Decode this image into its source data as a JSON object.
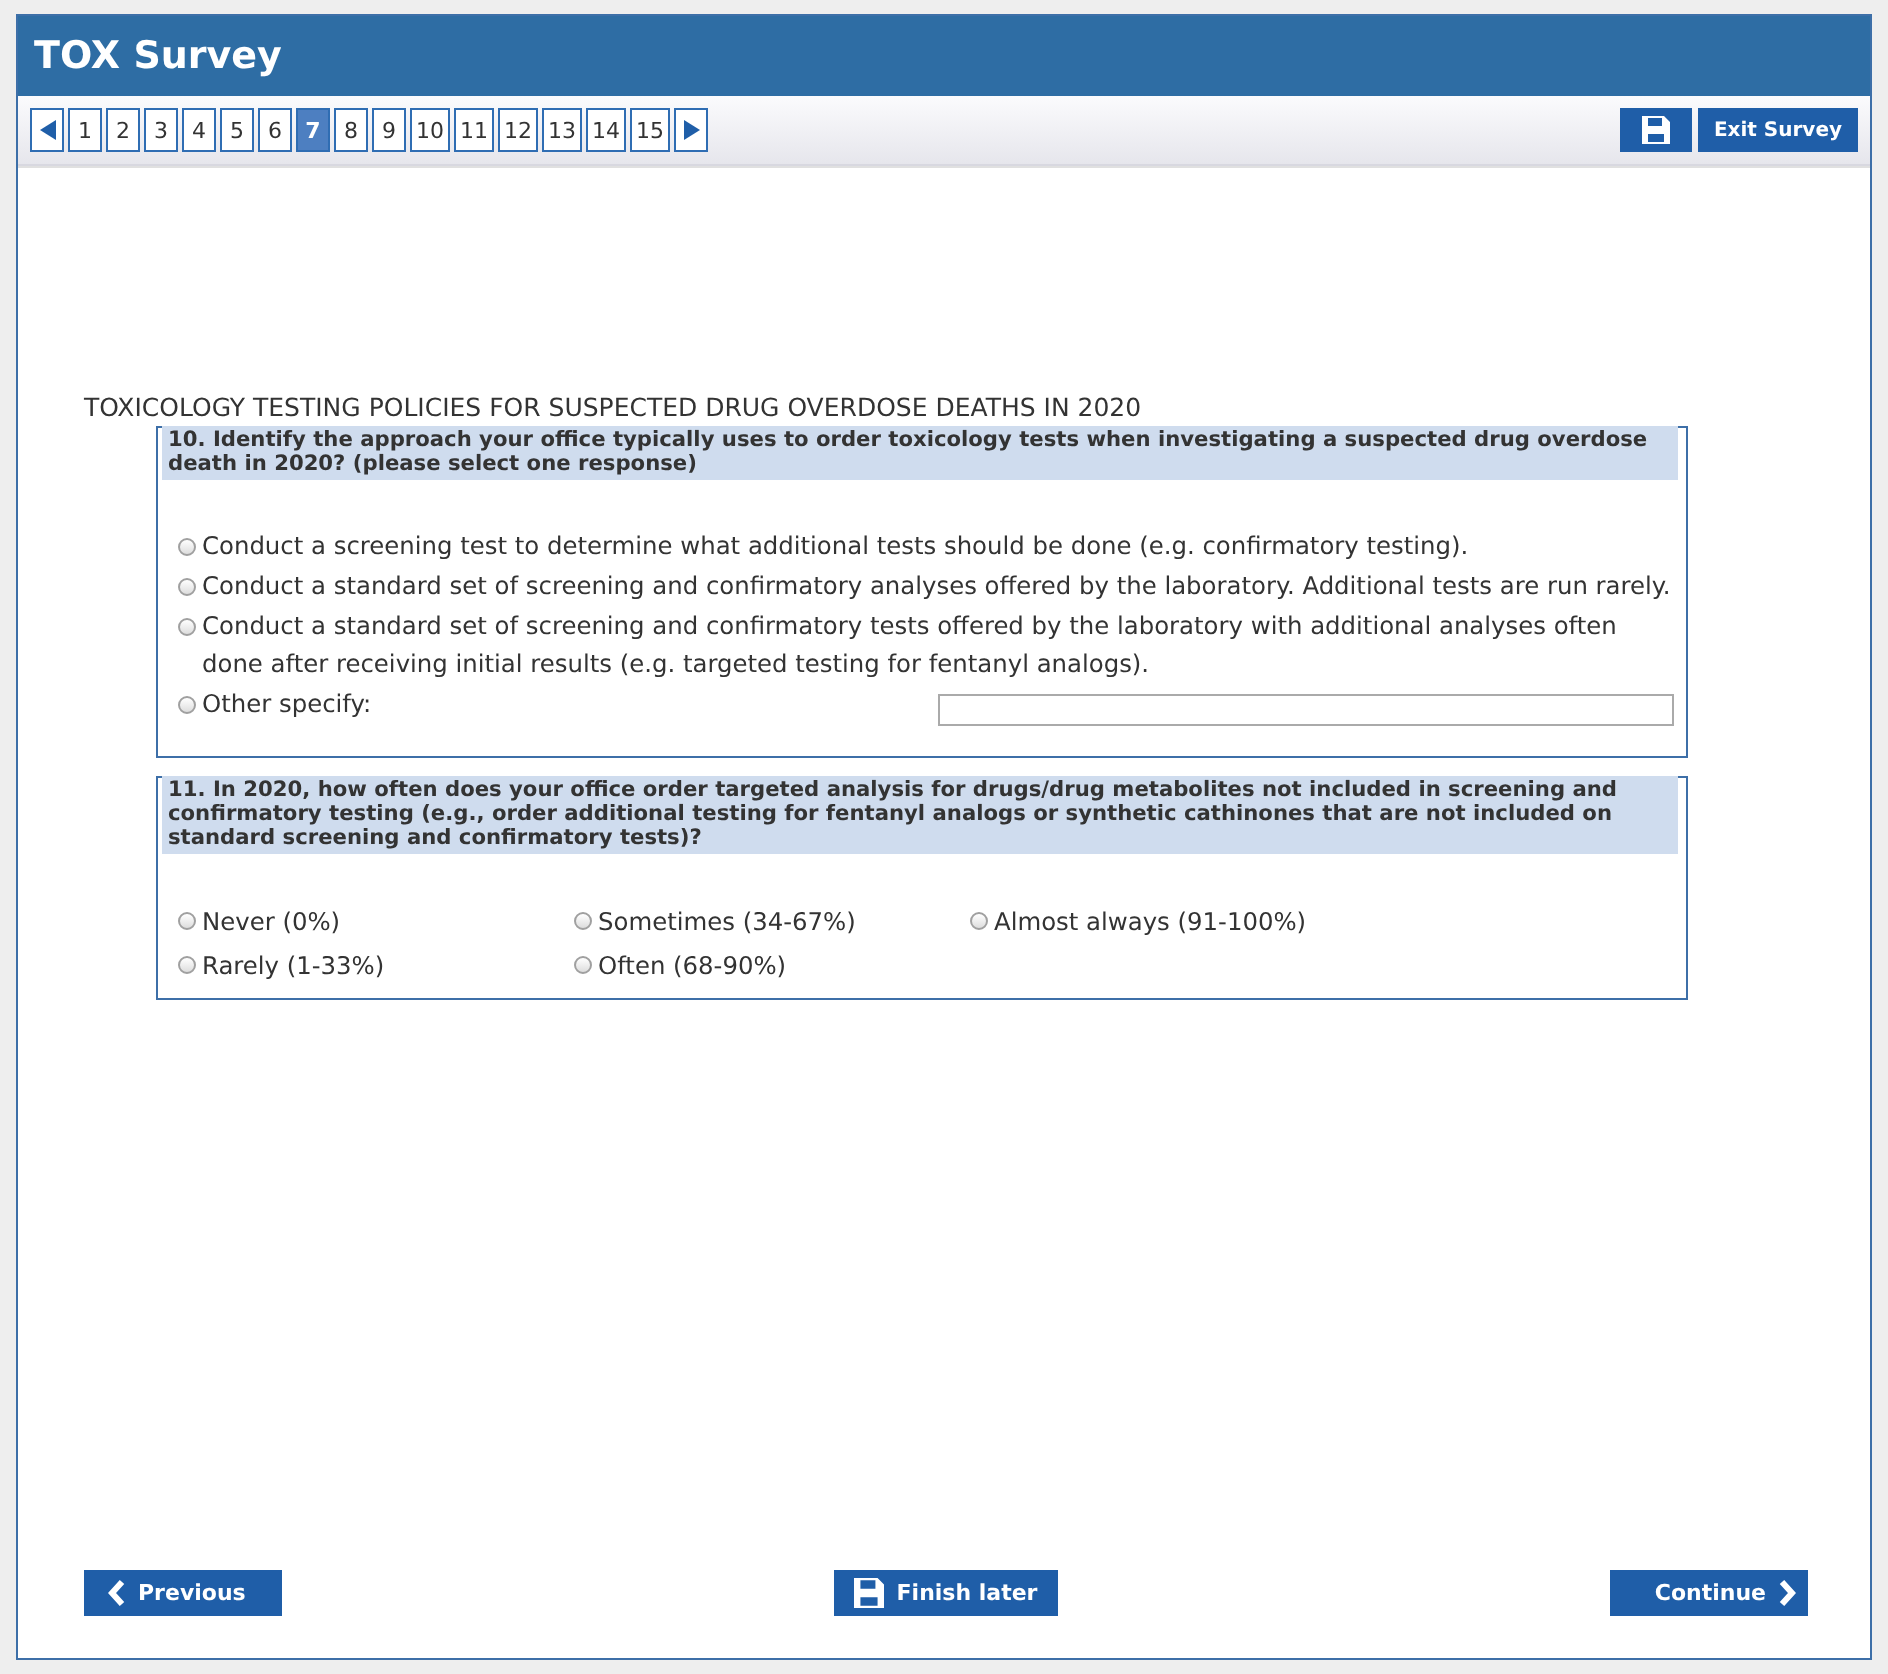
{
  "header": {
    "title": "TOX Survey"
  },
  "pages": [
    {
      "label": "1",
      "selected": false
    },
    {
      "label": "2",
      "selected": false
    },
    {
      "label": "3",
      "selected": false
    },
    {
      "label": "4",
      "selected": false
    },
    {
      "label": "5",
      "selected": false
    },
    {
      "label": "6",
      "selected": false
    },
    {
      "label": "7",
      "selected": true
    },
    {
      "label": "8",
      "selected": false
    },
    {
      "label": "9",
      "selected": false
    },
    {
      "label": "10",
      "selected": false
    },
    {
      "label": "11",
      "selected": false
    },
    {
      "label": "12",
      "selected": false
    },
    {
      "label": "13",
      "selected": false
    },
    {
      "label": "14",
      "selected": false
    },
    {
      "label": "15",
      "selected": false
    }
  ],
  "toolbar": {
    "exit_button": "Exit Survey"
  },
  "section_title": "TOXICOLOGY TESTING POLICIES FOR SUSPECTED DRUG OVERDOSE DEATHS IN 2020",
  "questions": [
    {
      "kind": "list",
      "text": "10. Identify the approach your office typically uses to order toxicology tests when investigating a suspected drug overdose death in 2020? (please select one response)",
      "options": [
        {
          "kind": "radio",
          "label": "Conduct a screening test to determine what additional tests should be done (e.g. confirmatory testing).",
          "selected": false
        },
        {
          "kind": "radio",
          "label": "Conduct a standard set of screening and confirmatory analyses offered by the laboratory. Additional tests are run rarely.",
          "selected": false
        },
        {
          "kind": "radio",
          "label": "Conduct a standard set of screening and confirmatory tests offered by the laboratory with additional analyses often done after receiving initial results (e.g. targeted testing for fentanyl analogs).",
          "selected": false
        },
        {
          "kind": "radio-with-field",
          "label": "Other specify:",
          "selected": false
        }
      ]
    },
    {
      "kind": "grid",
      "text": "11. In 2020, how often does your office order targeted analysis for drugs/drug metabolites not included in screening and confirmatory testing (e.g., order additional testing for fentanyl analogs or synthetic cathinones that are not included on standard screening and confirmatory tests)?",
      "options": [
        {
          "kind": "radio",
          "label": "Never (0%)",
          "selected": false
        },
        {
          "kind": "radio",
          "label": "Rarely (1-33%)",
          "selected": false
        },
        {
          "kind": "radio",
          "label": "Sometimes (34-67%)",
          "selected": false
        },
        {
          "kind": "radio",
          "label": "Often (68-90%)",
          "selected": false
        },
        {
          "kind": "radio",
          "label": "Almost always (91-100%)",
          "selected": false
        }
      ]
    }
  ],
  "footer": {
    "previous": "Previous",
    "finish_later": "Finish later",
    "continue": "Continue"
  }
}
